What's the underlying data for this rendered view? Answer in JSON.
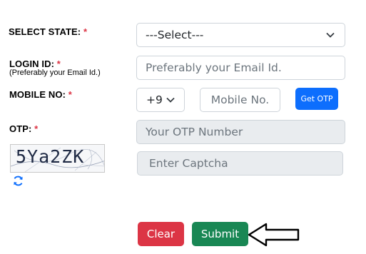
{
  "form": {
    "state": {
      "label": "SELECT STATE:",
      "required": "*",
      "selected": "---Select---"
    },
    "login": {
      "label": "LOGIN ID:",
      "required": "*",
      "sublabel": "(Preferably your Email Id.)",
      "placeholder": "Preferably your Email Id."
    },
    "mobile": {
      "label": "MOBILE NO:",
      "required": "*",
      "country_code": "+9",
      "placeholder": "Mobile No.",
      "get_otp_label": "Get OTP"
    },
    "otp": {
      "label": "OTP:",
      "required": "*",
      "placeholder": "Your OTP Number"
    },
    "captcha": {
      "image_text": "5Ya2ZK",
      "placeholder": "Enter Captcha",
      "refresh_icon": "refresh-icon"
    },
    "actions": {
      "clear_label": "Clear",
      "submit_label": "Submit"
    },
    "pointer_icon": "arrow-left-outline-icon"
  },
  "colors": {
    "required": "#dc3545",
    "get_otp": "#0d6efd",
    "clear": "#dc3545",
    "submit": "#198754",
    "disabled_field": "#e9ecef"
  }
}
